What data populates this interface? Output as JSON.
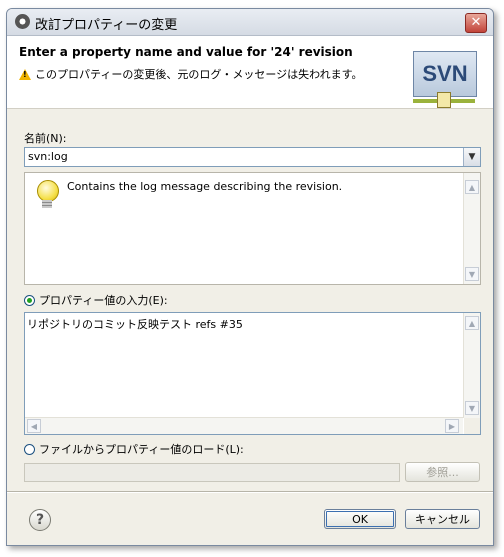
{
  "window": {
    "title": "改訂プロパティーの変更",
    "close_glyph": "✕"
  },
  "header": {
    "title": "Enter a property name and value for '24' revision",
    "warning": "このプロパティーの変更後、元のログ・メッセージは失われます。",
    "logo_text": "SVN"
  },
  "name_field": {
    "label": "名前(N):",
    "value": "svn:log"
  },
  "description": {
    "text": "Contains the log message describing the revision."
  },
  "value_option": {
    "label": "プロパティー値の入力(E):",
    "selected": true,
    "value": "リポジトリのコミット反映テスト refs #35"
  },
  "file_option": {
    "label": "ファイルからプロパティー値のロード(L):",
    "selected": false,
    "path": "",
    "browse_label": "参照..."
  },
  "footer": {
    "help_glyph": "?",
    "ok_label": "OK",
    "cancel_label": "キャンセル"
  },
  "icons": {
    "window": "svn-window-icon",
    "close": "close-icon",
    "warning": "warning-icon",
    "info": "lightbulb-icon",
    "help": "help-icon"
  },
  "colors": {
    "radio_selected": "#21a121",
    "close_button": "#c2443a",
    "warning": "#f0b400"
  }
}
